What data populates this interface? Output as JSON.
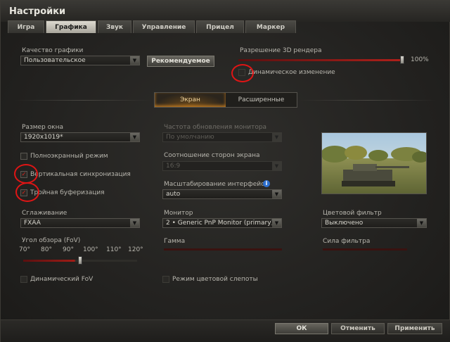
{
  "window": {
    "title": "Настройки"
  },
  "tabs": [
    {
      "label": "Игра",
      "active": false
    },
    {
      "label": "Графика",
      "active": true
    },
    {
      "label": "Звук",
      "active": false
    },
    {
      "label": "Управление",
      "active": false
    },
    {
      "label": "Прицел",
      "active": false
    },
    {
      "label": "Маркер",
      "active": false
    }
  ],
  "quality": {
    "label": "Качество графики",
    "value": "Пользовательское",
    "recommended_button": "Рекомендуемое"
  },
  "resolution3d": {
    "label": "Разрешение 3D рендера",
    "value_text": "100%",
    "value": 1.0,
    "dynamic_label": "Динамическое изменение",
    "dynamic_checked": false
  },
  "subtabs": {
    "screen": "Экран",
    "advanced": "Расширенные"
  },
  "window_size": {
    "label": "Размер окна",
    "value": "1920x1019*"
  },
  "fullscreen": {
    "label": "Полноэкранный режим",
    "checked": false
  },
  "vsync": {
    "label": "Вертикальная синхронизация",
    "checked": true
  },
  "triple_buffer": {
    "label": "Тройная буферизация",
    "checked": true
  },
  "refresh": {
    "label": "Частота обновления монитора",
    "value": "По умолчанию"
  },
  "aspect": {
    "label": "Соотношение сторон экрана",
    "value": "16:9"
  },
  "ui_scale": {
    "label": "Масштабирование интерфейса",
    "value": "auto"
  },
  "antialias": {
    "label": "Сглаживание",
    "value": "FXAA"
  },
  "monitor": {
    "label": "Монитор",
    "value": "2 • Generic PnP Monitor (primary)"
  },
  "color_filter": {
    "label": "Цветовой фильтр",
    "value": "Выключено"
  },
  "fov": {
    "label": "Угол обзора (FoV)",
    "ticks": [
      "70°",
      "80°",
      "90°",
      "100°",
      "110°",
      "120°"
    ],
    "value": 95
  },
  "gamma": {
    "label": "Гамма"
  },
  "filter_strength": {
    "label": "Сила фильтра"
  },
  "dynamic_fov": {
    "label": "Динамический FoV",
    "checked": false
  },
  "colorblind": {
    "label": "Режим цветовой слепоты",
    "checked": false
  },
  "footer": {
    "ok": "ОК",
    "cancel": "Отменить",
    "apply": "Применить"
  },
  "colors": {
    "accent_red": "#e01515",
    "check_mark": "#e3261d",
    "active_tab_glow": "#c07a20"
  }
}
